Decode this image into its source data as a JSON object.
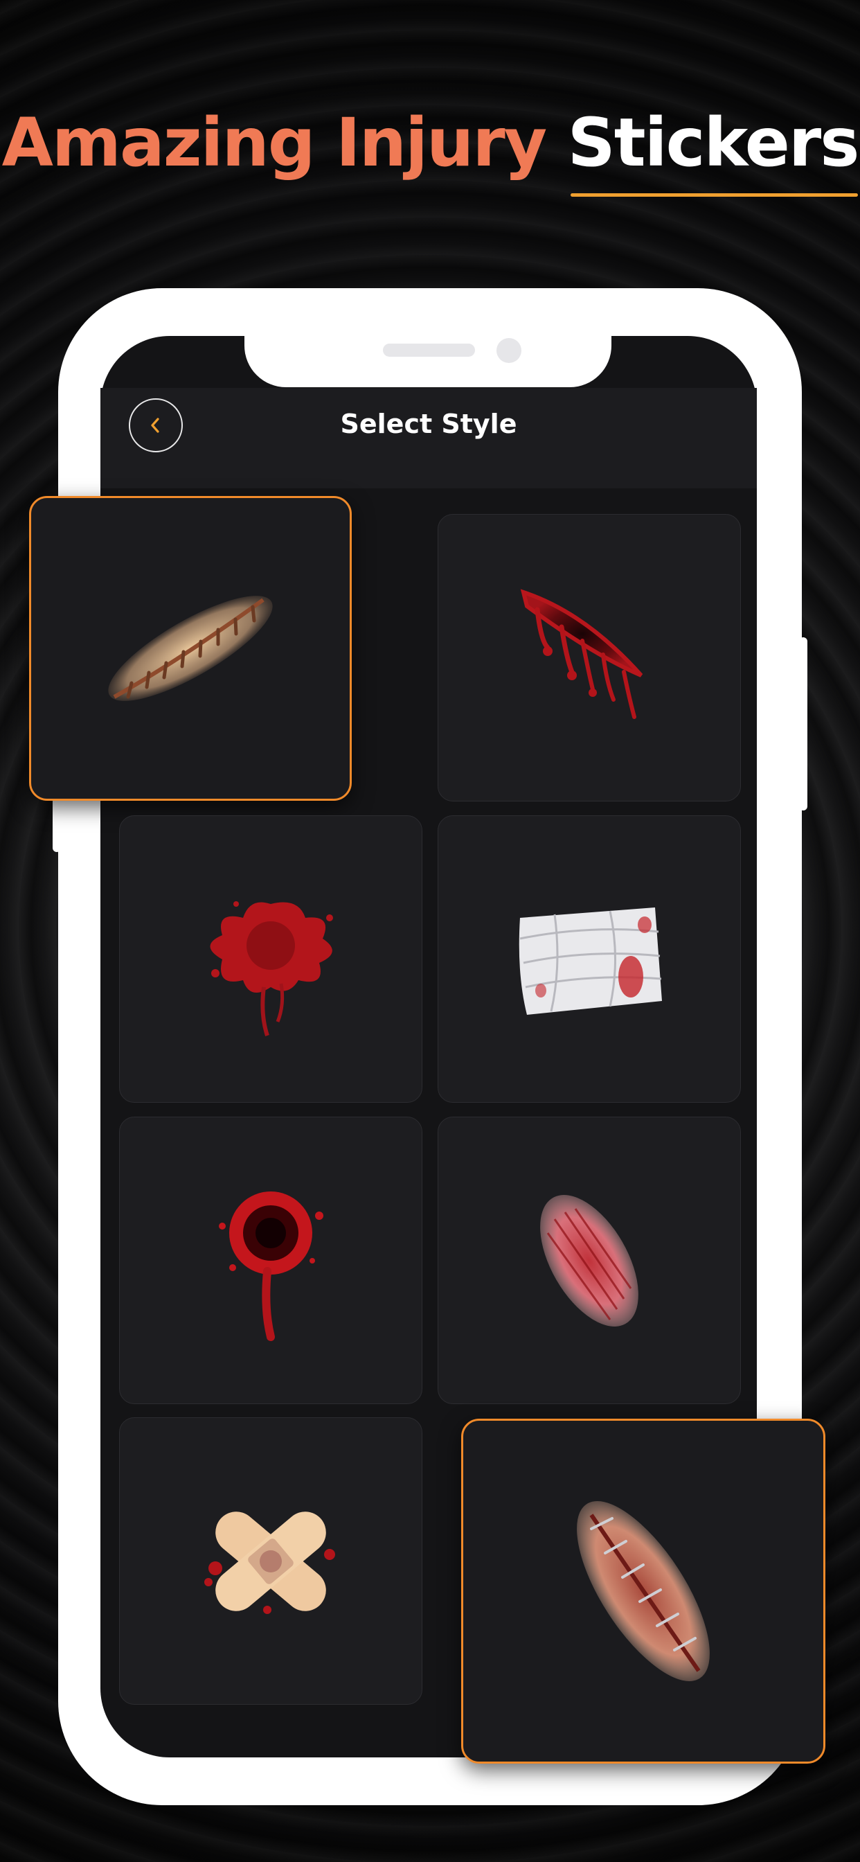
{
  "headline": {
    "part1": "Amazing Injury",
    "part2": "Stickers"
  },
  "app": {
    "title": "Select Style"
  },
  "colors": {
    "accent_orange": "#f07a55",
    "underline": "#f0a030",
    "selection_border": "#f08a2a",
    "tile_bg": "#1d1d20"
  },
  "stickers": [
    {
      "name": "stitched-scar",
      "icon": "stitched-scar-icon",
      "highlighted": true
    },
    {
      "name": "bloody-gash",
      "icon": "bloody-gash-icon",
      "highlighted": false
    },
    {
      "name": "blood-splatter",
      "icon": "blood-splatter-icon",
      "highlighted": false
    },
    {
      "name": "bandage-wrap",
      "icon": "bandage-wrap-icon",
      "highlighted": false
    },
    {
      "name": "bullet-wound",
      "icon": "bullet-wound-icon",
      "highlighted": false
    },
    {
      "name": "scrape-abrasion",
      "icon": "scrape-abrasion-icon",
      "highlighted": false
    },
    {
      "name": "cross-bandage",
      "icon": "cross-bandage-icon",
      "highlighted": false
    },
    {
      "name": "stapled-wound",
      "icon": "stapled-wound-icon",
      "highlighted": true
    }
  ]
}
